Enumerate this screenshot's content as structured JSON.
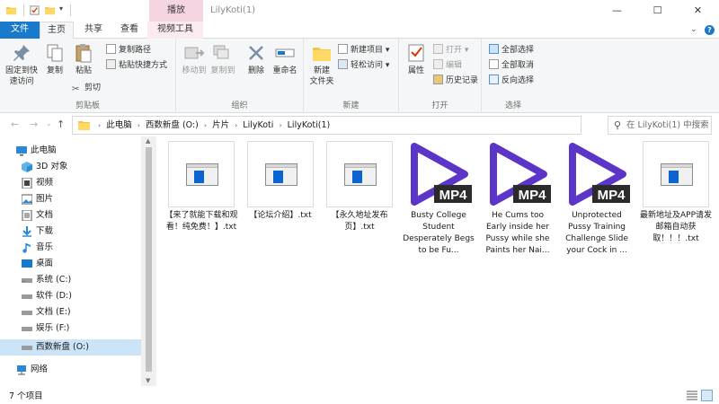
{
  "window": {
    "title": "LilyKoti(1)",
    "context_tab_header": "播放",
    "minimize": "—",
    "maximize": "☐",
    "close": "✕"
  },
  "tabs": {
    "file": "文件",
    "home": "主页",
    "share": "共享",
    "view": "查看",
    "video_tools": "视频工具"
  },
  "ribbon": {
    "clipboard": {
      "label": "剪贴板",
      "pin": "固定到快\n速访问",
      "copy": "复制",
      "paste": "粘贴",
      "copy_path": "复制路径",
      "paste_shortcut": "粘贴快捷方式",
      "cut": "剪切"
    },
    "organize": {
      "label": "组织",
      "move_to": "移动到",
      "copy_to": "复制到",
      "delete": "删除",
      "rename": "重命名"
    },
    "new": {
      "label": "新建",
      "new_folder": "新建\n文件夹",
      "new_item": "新建项目 ▾",
      "easy_access": "轻松访问 ▾"
    },
    "open": {
      "label": "打开",
      "properties": "属性",
      "open": "打开 ▾",
      "edit": "编辑",
      "history": "历史记录"
    },
    "select": {
      "label": "选择",
      "select_all": "全部选择",
      "select_none": "全部取消",
      "invert": "反向选择"
    }
  },
  "address": {
    "crumbs": [
      "此电脑",
      "西数新盘 (O:)",
      "片片",
      "LilyKoti",
      "LilyKoti(1)"
    ],
    "search_placeholder": "在 LilyKoti(1) 中搜索"
  },
  "navpane": {
    "items": [
      {
        "label": "此电脑",
        "icon": "computer-icon"
      },
      {
        "label": "3D 对象",
        "icon": "3d-objects-icon"
      },
      {
        "label": "视频",
        "icon": "videos-icon"
      },
      {
        "label": "图片",
        "icon": "pictures-icon"
      },
      {
        "label": "文档",
        "icon": "documents-icon"
      },
      {
        "label": "下载",
        "icon": "downloads-icon"
      },
      {
        "label": "音乐",
        "icon": "music-icon"
      },
      {
        "label": "桌面",
        "icon": "desktop-icon"
      },
      {
        "label": "系统 (C:)",
        "icon": "drive-icon"
      },
      {
        "label": "软件 (D:)",
        "icon": "drive-icon"
      },
      {
        "label": "文档 (E:)",
        "icon": "drive-icon"
      },
      {
        "label": "娱乐 (F:)",
        "icon": "drive-icon"
      },
      {
        "label": "西数新盘 (O:)",
        "icon": "drive-icon",
        "selected": true
      },
      {
        "label": "网络",
        "icon": "network-icon"
      }
    ]
  },
  "files": [
    {
      "name": "【来了就能下载和观看！纯免费！】.txt",
      "type": "txt"
    },
    {
      "name": "【论坛介绍】.txt",
      "type": "txt"
    },
    {
      "name": "【永久地址发布页】.txt",
      "type": "txt"
    },
    {
      "name": "Busty College Student Desperately Begs to be Fu...",
      "type": "mp4",
      "badge": "MP4"
    },
    {
      "name": "He Cums too Early inside her Pussy while she Paints her Nai...",
      "type": "mp4",
      "badge": "MP4"
    },
    {
      "name": "Unprotected Pussy Training Challenge Slide your Cock in ...",
      "type": "mp4",
      "badge": "MP4"
    },
    {
      "name": "最新地址及APP请发邮箱自动获取！！！.txt",
      "type": "txt"
    }
  ],
  "status": {
    "count": "7 个项目"
  },
  "colors": {
    "accent": "#1979ca",
    "mp4_purple": "#5a35c8",
    "video_tools_tab": "#f6d5e2",
    "selection": "#cce4f7"
  }
}
